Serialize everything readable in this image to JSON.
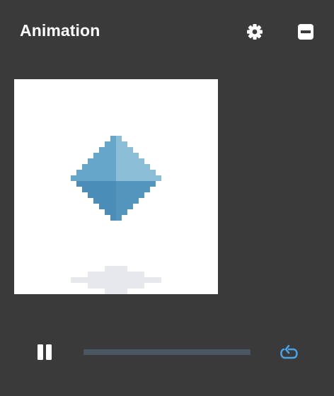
{
  "panel": {
    "title": "Animation"
  },
  "icons": {
    "settings": "gear-icon",
    "minimize": "minimize-icon",
    "pause": "pause-icon",
    "replay": "replay-icon"
  },
  "playback": {
    "state": "playing",
    "progress": 0.0
  },
  "colors": {
    "background": "#3a3a3a",
    "canvas": "#ffffff",
    "gem_light": "#8bbdd6",
    "gem_mid": "#65a6ca",
    "gem_dark": "#5395bd",
    "gem_darker": "#4a8db6",
    "shadow": "#e6e8eb",
    "track": "#4b5663",
    "accent": "#4aa3e8"
  }
}
